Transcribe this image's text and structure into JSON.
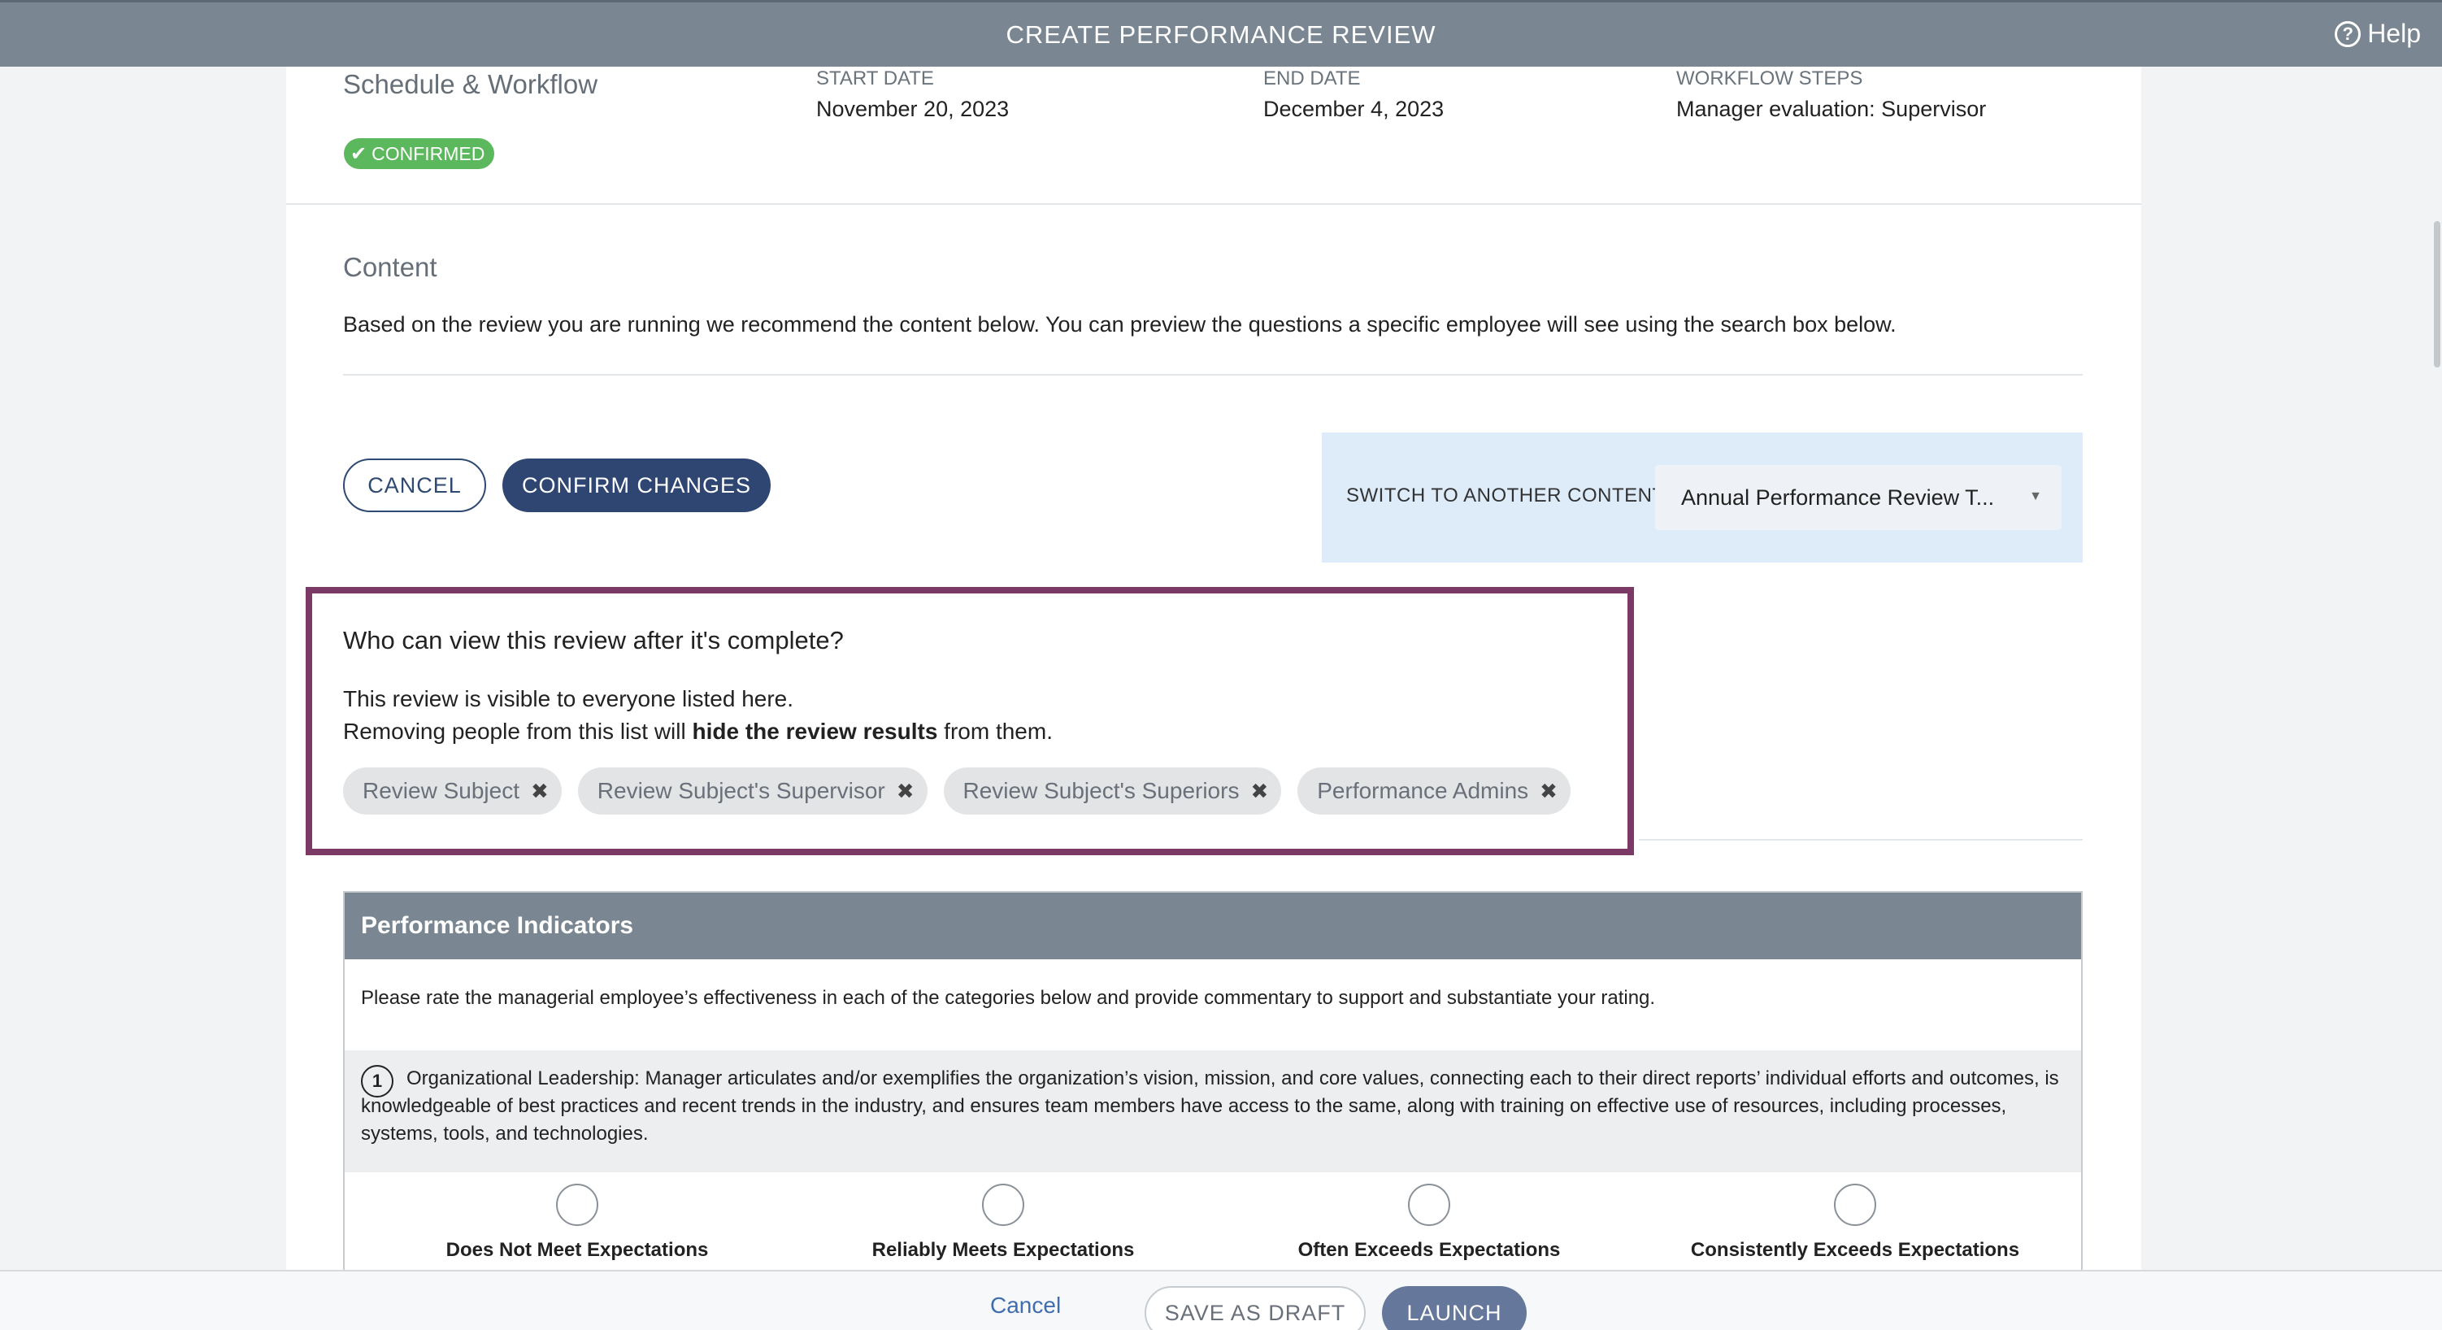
{
  "header": {
    "title": "CREATE PERFORMANCE REVIEW",
    "help_label": "Help"
  },
  "schedule": {
    "title": "Schedule & Workflow",
    "status_badge": "CONFIRMED",
    "start_date_label": "START DATE",
    "start_date": "November 20, 2023",
    "end_date_label": "END DATE",
    "end_date": "December 4, 2023",
    "workflow_label": "WORKFLOW STEPS",
    "workflow_value": "Manager evaluation: Supervisor"
  },
  "content": {
    "title": "Content",
    "description": "Based on the review you are running we recommend the content below. You can preview the questions a specific employee will see using the search box below.",
    "cancel_label": "CANCEL",
    "confirm_label": "CONFIRM CHANGES",
    "switch_label": "SWITCH TO ANOTHER CONTENT",
    "switch_selected": "Annual Performance Review T..."
  },
  "visibility": {
    "title": "Who can view this review after it's complete?",
    "line1": "This review is visible to everyone listed here.",
    "line2_prefix": "Removing people from this list will ",
    "line2_bold": "hide the review results",
    "line2_suffix": " from them.",
    "chips": [
      "Review Subject",
      "Review Subject's Supervisor",
      "Review Subject's Superiors",
      "Performance Admins"
    ]
  },
  "performance": {
    "title": "Performance Indicators",
    "instructions": "Please rate the managerial employee’s effectiveness in each of the categories below and provide commentary to support and substantiate your rating.",
    "question_number": "1",
    "question_text": "Organizational Leadership: Manager articulates and/or exemplifies the organization’s vision, mission, and core values, connecting each to their direct reports’ individual efforts and outcomes, is knowledgeable of best practices and recent trends in the industry, and ensures team members have access to the same, along with training on effective use of resources, including processes, systems, tools, and technologies.",
    "ratings": [
      "Does Not Meet Expectations",
      "Reliably Meets Expectations",
      "Often Exceeds Expectations",
      "Consistently Exceeds Expectations"
    ]
  },
  "footer": {
    "cancel_label": "Cancel",
    "draft_label": "SAVE AS DRAFT",
    "launch_label": "LAUNCH"
  }
}
